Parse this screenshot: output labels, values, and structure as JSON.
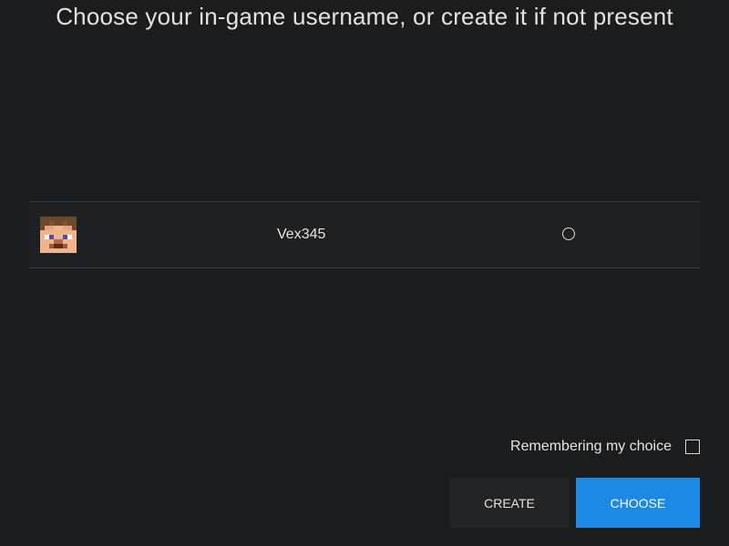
{
  "header": {
    "title": "Choose your in-game username, or create it if not present"
  },
  "profiles": [
    {
      "username": "Vex345",
      "avatar_icon": "steve-head-icon",
      "selected": false
    }
  ],
  "options": {
    "remember_label": "Remembering my choice",
    "remember_checked": false
  },
  "actions": {
    "create_label": "CREATE",
    "choose_label": "CHOOSE"
  },
  "colors": {
    "background": "#1b1c1e",
    "accent": "#1e88e5",
    "secondary_button": "#232426"
  }
}
